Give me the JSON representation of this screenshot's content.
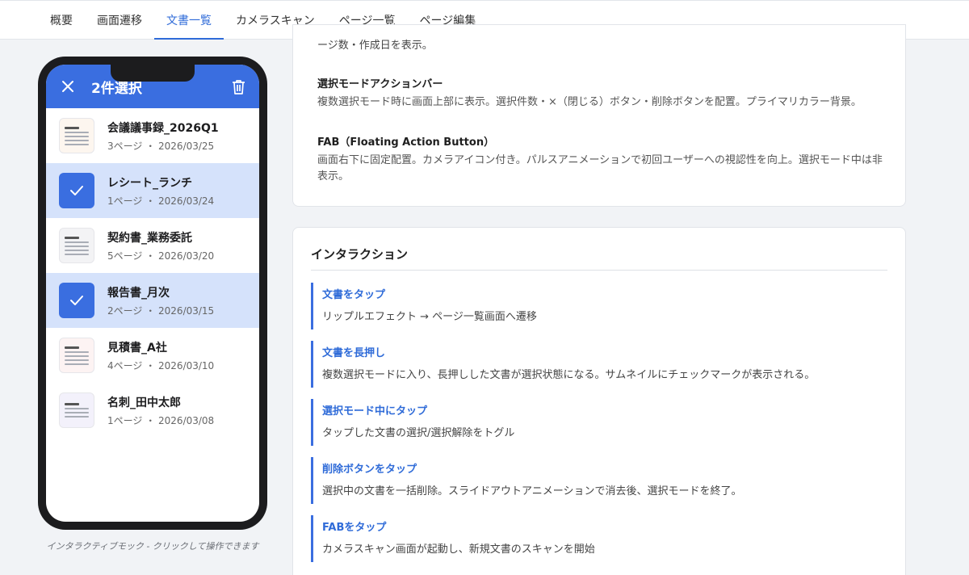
{
  "tabs": [
    "概要",
    "画面遷移",
    "文書一覧",
    "カメラスキャン",
    "ページ一覧",
    "ページ編集"
  ],
  "active_tab": "文書一覧",
  "phone": {
    "selection_label": "2件選択",
    "documents": [
      {
        "name": "会議議事録_2026Q1",
        "meta": "3ページ ・ 2026/03/25",
        "selected": false,
        "thumb": "warm"
      },
      {
        "name": "レシート_ランチ",
        "meta": "1ページ ・ 2026/03/24",
        "selected": true,
        "thumb": ""
      },
      {
        "name": "契約書_業務委託",
        "meta": "5ページ ・ 2026/03/20",
        "selected": false,
        "thumb": "gray"
      },
      {
        "name": "報告書_月次",
        "meta": "2ページ ・ 2026/03/15",
        "selected": true,
        "thumb": ""
      },
      {
        "name": "見積書_A社",
        "meta": "4ページ ・ 2026/03/10",
        "selected": false,
        "thumb": "pink"
      },
      {
        "name": "名刺_田中太郎",
        "meta": "1ページ ・ 2026/03/08",
        "selected": false,
        "thumb": "lav"
      }
    ],
    "caption": "インタラクティブモック - クリックして操作できます"
  },
  "spec": {
    "cut_text": "ージ数・作成日を表示。",
    "components": [
      {
        "title": "選択モードアクションバー",
        "desc": "複数選択モード時に画面上部に表示。選択件数・×（閉じる）ボタン・削除ボタンを配置。プライマリカラー背景。"
      },
      {
        "title": "FAB（Floating Action Button）",
        "desc": "画面右下に固定配置。カメラアイコン付き。パルスアニメーションで初回ユーザーへの視認性を向上。選択モード中は非表示。"
      }
    ],
    "interaction_title": "インタラクション",
    "interactions": [
      {
        "title": "文書をタップ",
        "desc": "リップルエフェクト → ページ一覧画面へ遷移"
      },
      {
        "title": "文書を長押し",
        "desc": "複数選択モードに入り、長押しした文書が選択状態になる。サムネイルにチェックマークが表示される。"
      },
      {
        "title": "選択モード中にタップ",
        "desc": "タップした文書の選択/選択解除をトグル"
      },
      {
        "title": "削除ボタンをタップ",
        "desc": "選択中の文書を一括削除。スライドアウトアニメーションで消去後、選択モードを終了。"
      },
      {
        "title": "FABをタップ",
        "desc": "カメラスキャン画面が起動し、新規文書のスキャンを開始"
      }
    ]
  }
}
